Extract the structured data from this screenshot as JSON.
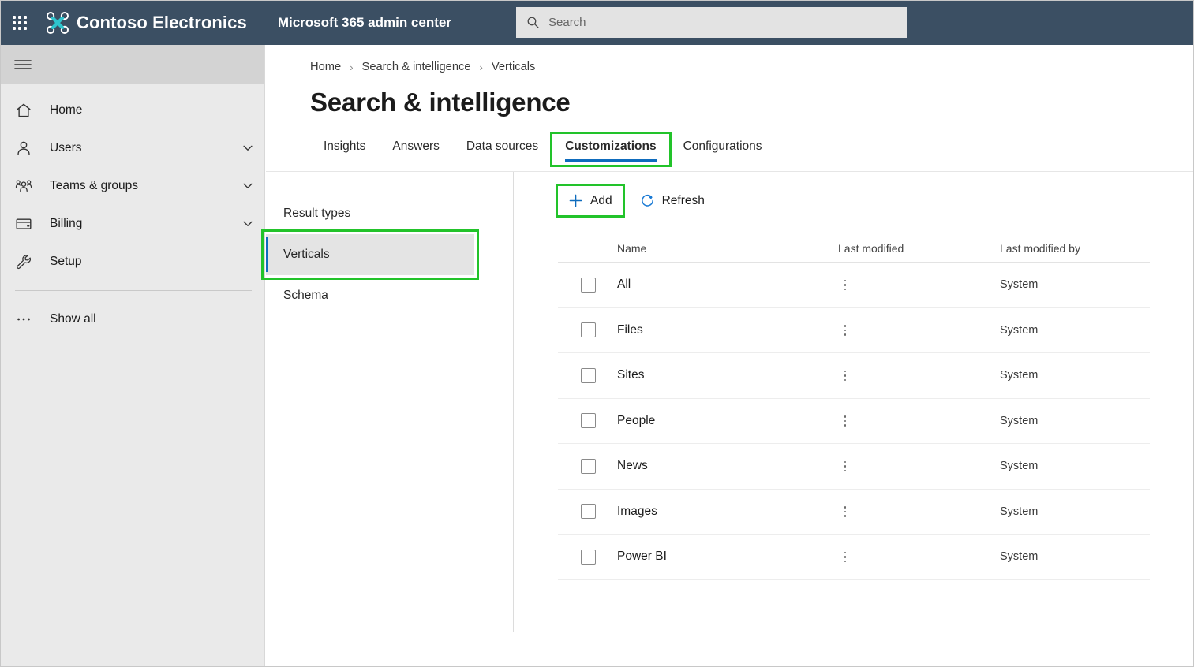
{
  "header": {
    "waffle_icon": "app-launcher-waffle-icon",
    "brand_logo_icon": "drone-logo-icon",
    "brand_name": "Contoso Electronics",
    "app_title": "Microsoft 365 admin center",
    "search": {
      "icon": "search-icon",
      "placeholder": "Search",
      "value": ""
    },
    "background_color": "#3b4f63"
  },
  "sidebar": {
    "hamburger_icon": "hamburger-menu-icon",
    "items": [
      {
        "label": "Home",
        "icon": "home-icon",
        "expandable": false
      },
      {
        "label": "Users",
        "icon": "user-icon",
        "expandable": true
      },
      {
        "label": "Teams & groups",
        "icon": "people-group-icon",
        "expandable": true
      },
      {
        "label": "Billing",
        "icon": "credit-card-icon",
        "expandable": true
      },
      {
        "label": "Setup",
        "icon": "wrench-icon",
        "expandable": false
      }
    ],
    "show_all": {
      "label": "Show all",
      "icon": "ellipsis-icon"
    }
  },
  "breadcrumb": {
    "items": [
      "Home",
      "Search & intelligence",
      "Verticals"
    ],
    "separator": "›"
  },
  "page": {
    "title": "Search & intelligence"
  },
  "tabs": [
    {
      "label": "Insights",
      "active": false,
      "annotated": false
    },
    {
      "label": "Answers",
      "active": false,
      "annotated": false
    },
    {
      "label": "Data sources",
      "active": false,
      "annotated": false
    },
    {
      "label": "Customizations",
      "active": true,
      "annotated": true
    },
    {
      "label": "Configurations",
      "active": false,
      "annotated": false
    }
  ],
  "subnav": [
    {
      "label": "Result types",
      "selected": false,
      "annotated": false
    },
    {
      "label": "Verticals",
      "selected": true,
      "annotated": true
    },
    {
      "label": "Schema",
      "selected": false,
      "annotated": false
    }
  ],
  "toolbar": {
    "add": {
      "label": "Add",
      "icon": "plus-icon",
      "annotated": true
    },
    "refresh": {
      "label": "Refresh",
      "icon": "refresh-icon",
      "annotated": false
    }
  },
  "table": {
    "columns": [
      "Name",
      "Last modified",
      "Last modified by"
    ],
    "rows": [
      {
        "checked": false,
        "name": "All",
        "last_modified": "",
        "last_modified_by": "System"
      },
      {
        "checked": false,
        "name": "Files",
        "last_modified": "",
        "last_modified_by": "System"
      },
      {
        "checked": false,
        "name": "Sites",
        "last_modified": "",
        "last_modified_by": "System"
      },
      {
        "checked": false,
        "name": "People",
        "last_modified": "",
        "last_modified_by": "System"
      },
      {
        "checked": false,
        "name": "News",
        "last_modified": "",
        "last_modified_by": "System"
      },
      {
        "checked": false,
        "name": "Images",
        "last_modified": "",
        "last_modified_by": "System"
      },
      {
        "checked": false,
        "name": "Power BI",
        "last_modified": "",
        "last_modified_by": "System"
      }
    ],
    "row_menu_icon": "more-options-kebab-icon"
  },
  "colors": {
    "header_bg": "#3b4f63",
    "accent_blue": "#0f6cbd",
    "annotation_green": "#22c32a",
    "sidebar_bg": "#eaeaea",
    "logo_teal": "#2ec5ce"
  }
}
